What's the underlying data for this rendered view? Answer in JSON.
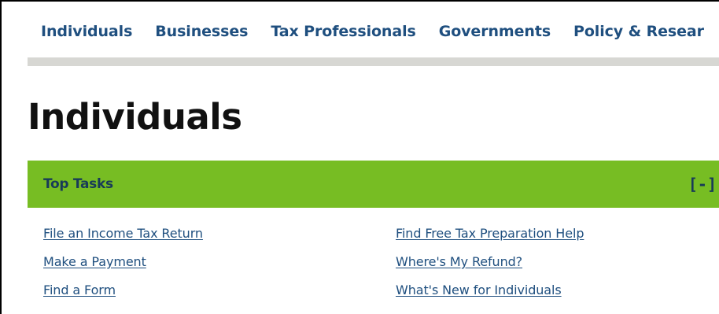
{
  "topnav": {
    "items": [
      {
        "label": "Individuals"
      },
      {
        "label": "Businesses"
      },
      {
        "label": "Tax Professionals"
      },
      {
        "label": "Governments"
      },
      {
        "label": "Policy & Resear"
      }
    ]
  },
  "page": {
    "title": "Individuals"
  },
  "top_tasks": {
    "title": "Top Tasks",
    "toggle": "[-]",
    "left_links": [
      {
        "label": "File an Income Tax Return"
      },
      {
        "label": "Make a Payment"
      },
      {
        "label": "Find a Form"
      }
    ],
    "right_links": [
      {
        "label": "Find Free Tax Preparation Help"
      },
      {
        "label": "Where's My Refund?"
      },
      {
        "label": "What's New for Individuals"
      }
    ]
  },
  "colors": {
    "nav_link": "#1f4f7f",
    "accordion_header": "#77bd23",
    "accordion_text": "#183b58",
    "nav_rule": "#d7d7d3",
    "page_title": "#111111"
  }
}
